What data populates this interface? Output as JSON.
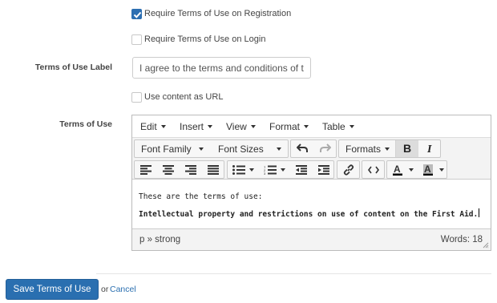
{
  "options": {
    "require_registration": {
      "label": "Require Terms of Use on Registration",
      "checked": true
    },
    "require_login": {
      "label": "Require Terms of Use on Login",
      "checked": false
    },
    "use_content_as_url": {
      "label": "Use content as URL",
      "checked": false
    }
  },
  "terms_label": {
    "label": "Terms of Use Label",
    "value": "I agree to the terms and conditions of this"
  },
  "terms_of_use": {
    "label": "Terms of Use",
    "menubar": [
      "Edit",
      "Insert",
      "View",
      "Format",
      "Table"
    ],
    "toolbar": {
      "font_family": "Font Family",
      "font_sizes": "Font Sizes",
      "formats": "Formats",
      "icons": [
        "undo-icon",
        "redo-icon",
        "bold-icon",
        "italic-icon",
        "align-left-icon",
        "align-center-icon",
        "align-right-icon",
        "align-justify-icon",
        "bullet-list-icon",
        "numbered-list-icon",
        "outdent-icon",
        "indent-icon",
        "link-icon",
        "code-icon",
        "text-color-icon",
        "background-color-icon"
      ]
    },
    "content": {
      "paragraph1": "These are the terms of use:",
      "paragraph2": "Intellectual property and restrictions on use of content on the First Aid."
    },
    "status": {
      "path": "p » strong",
      "words": "Words: 18"
    }
  },
  "actions": {
    "save": "Save Terms of Use",
    "or": "or",
    "cancel": "Cancel"
  },
  "colors": {
    "accent": "#2a6fb0",
    "toolbar_bg": "#f3f3f3"
  }
}
